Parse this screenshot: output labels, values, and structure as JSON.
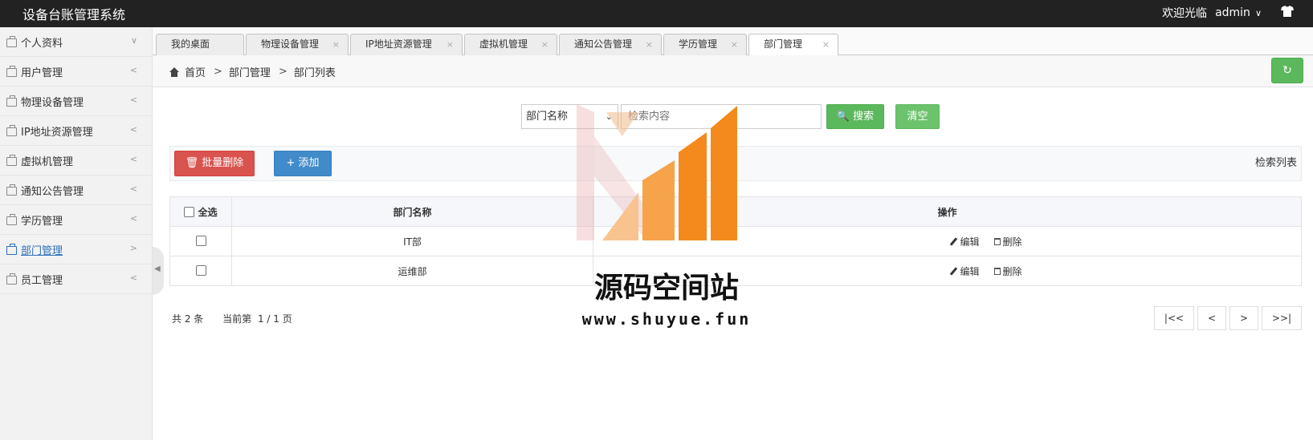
{
  "header": {
    "title": "设备台账管理系统",
    "welcome": "欢迎光临",
    "username": "admin",
    "chevron": "∨",
    "shirt_icon": "shirt-icon"
  },
  "sidebar": {
    "items": [
      {
        "label": "个人资料",
        "arrow": "∨"
      },
      {
        "label": "用户管理",
        "arrow": "<"
      },
      {
        "label": "物理设备管理",
        "arrow": "<"
      },
      {
        "label": "IP地址资源管理",
        "arrow": "<"
      },
      {
        "label": "虚拟机管理",
        "arrow": "<"
      },
      {
        "label": "通知公告管理",
        "arrow": "<"
      },
      {
        "label": "学历管理",
        "arrow": "<"
      },
      {
        "label": "部门管理",
        "arrow": ">"
      },
      {
        "label": "员工管理",
        "arrow": "<"
      }
    ],
    "collapse_glyph": "◀"
  },
  "tabs": [
    {
      "label": "我的桌面"
    },
    {
      "label": "物理设备管理",
      "close": "×"
    },
    {
      "label": "IP地址资源管理",
      "close": "×"
    },
    {
      "label": "虚拟机管理",
      "close": "×"
    },
    {
      "label": "通知公告管理",
      "close": "×"
    },
    {
      "label": "学历管理",
      "close": "×"
    },
    {
      "label": "部门管理",
      "close": "×"
    }
  ],
  "breadcrumb": {
    "home": "首页",
    "sep": ">",
    "level1": "部门管理",
    "level2": "部门列表"
  },
  "refresh_glyph": "↻",
  "search": {
    "field_selected": "部门名称",
    "caret": "⌄",
    "placeholder": "检索内容",
    "search_label": "🔍 搜索",
    "clear_label": "清空"
  },
  "toolbar": {
    "batch_delete_label": "🗑 批量删除",
    "add_label": "+ 添加",
    "list_label": "检索列表"
  },
  "table": {
    "headers": {
      "select_all": "全选",
      "name": "部门名称",
      "actions": "操作"
    },
    "rows": [
      {
        "name": "IT部",
        "edit": "编辑",
        "delete": "删除"
      },
      {
        "name": "运维部",
        "edit": "编辑",
        "delete": "删除"
      }
    ]
  },
  "summary": {
    "total": "共 2 条",
    "current_label": "当前第",
    "page": "1 / 1 页"
  },
  "pagination": {
    "first": "|<<",
    "prev": "<",
    "next": ">",
    "last": ">>|"
  },
  "watermark": {
    "text": "源码空间站",
    "url": "www.shuyue.fun"
  },
  "colors": {
    "success": "#5cb85c",
    "danger": "#d9534f",
    "primary": "#428bca",
    "header_bg": "#222222",
    "active_link": "#2a6ebb",
    "watermark_orange": "#f48a1d"
  }
}
